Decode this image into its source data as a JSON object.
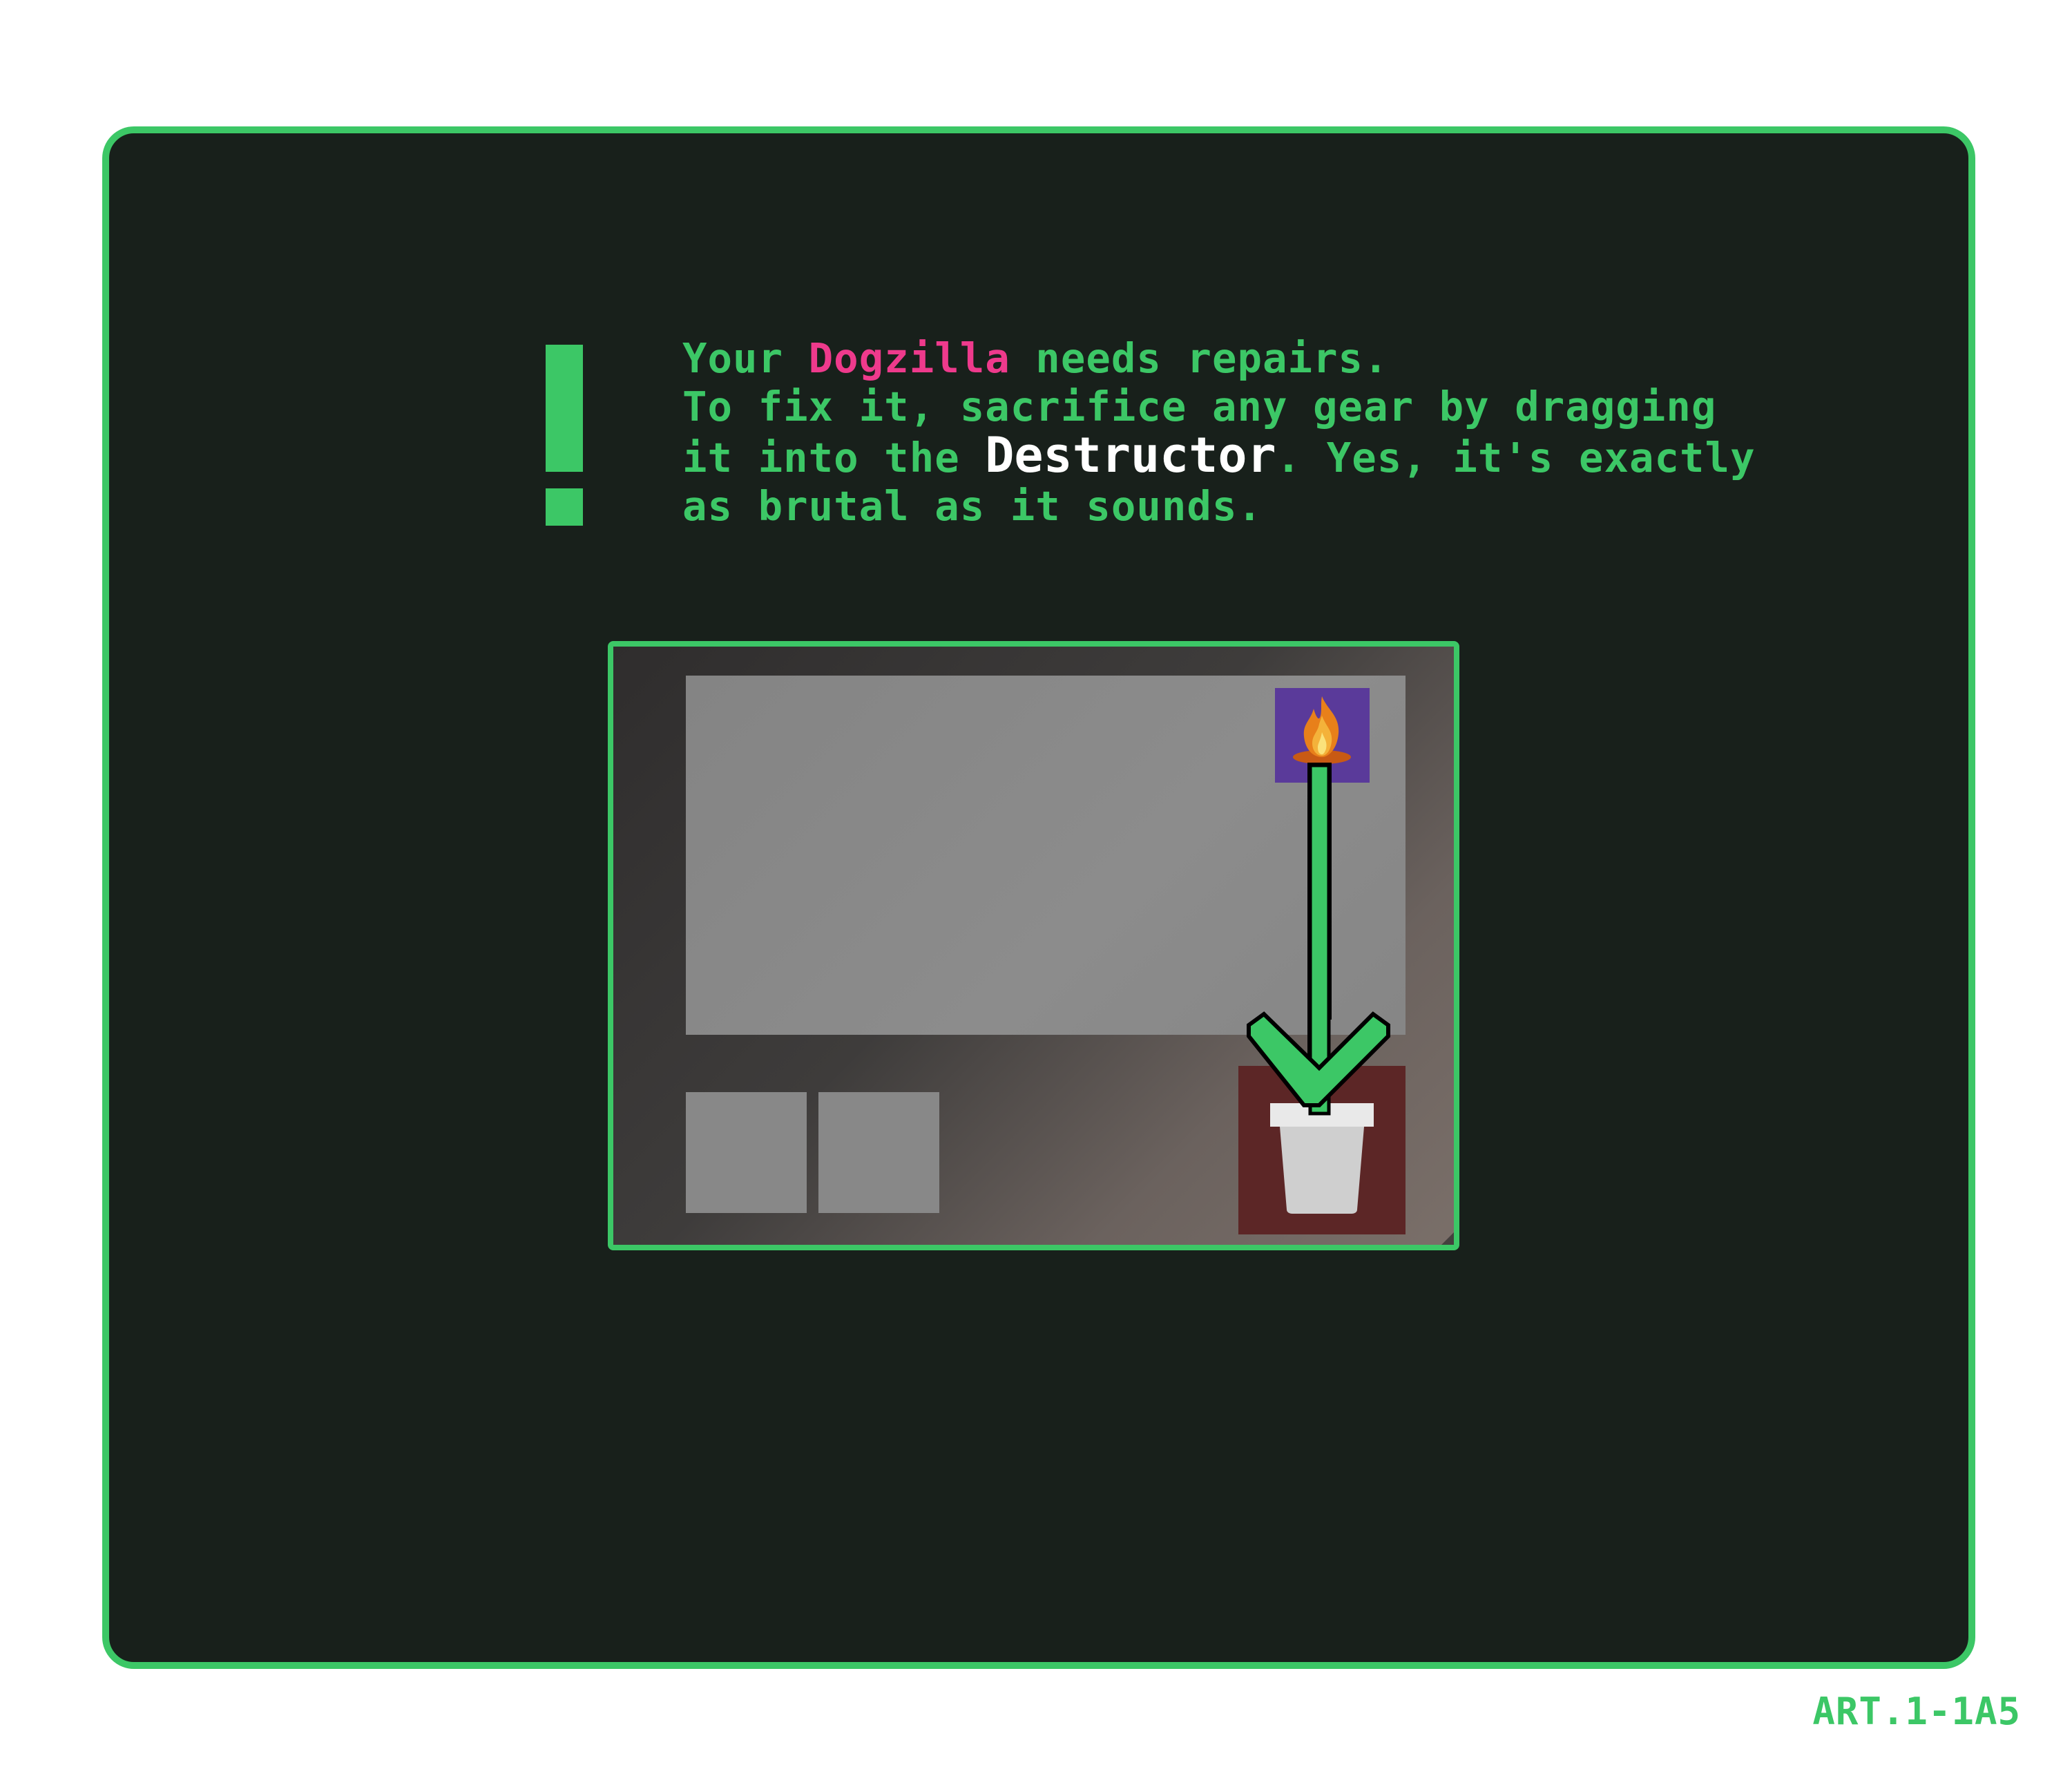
{
  "tutorial": {
    "message_lines": [
      {
        "before": "Your ",
        "highlight": "Dogzilla",
        "after": " needs repairs."
      },
      {
        "text": "To fix it, sacrifice any gear by dragging"
      },
      {
        "before": "it into the ",
        "highlight": "Destructor",
        "after": ". Yes, it's exactly"
      },
      {
        "text": "as brutal as it sounds."
      }
    ],
    "code_label": "ART.1-1A5"
  },
  "game_scene": {
    "gear_slot_icon": "flame-icon",
    "destructor_icon": "trash-bin-icon",
    "arrow_icon": "drag-arrow-down-icon"
  },
  "colors": {
    "accent_green": "#3cc766",
    "highlight_pink": "#ee3a8c",
    "card_background": "#18201b",
    "gear_slot": "#5a3a9a",
    "destructor_slot": "#5c2626"
  }
}
